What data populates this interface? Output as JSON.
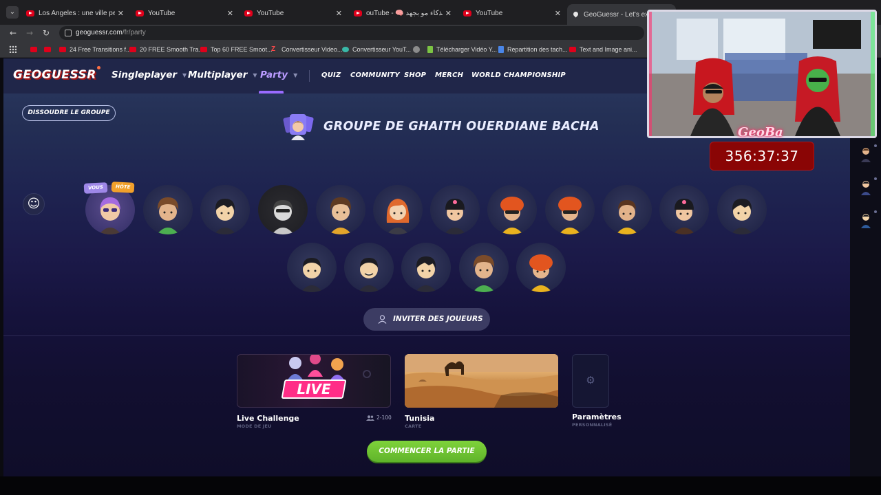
{
  "browser": {
    "tabs": [
      {
        "label": "Los Angeles : une ville peuplée",
        "icon": "youtube-icon"
      },
      {
        "label": "YouTube",
        "icon": "youtube-icon"
      },
      {
        "label": "YouTube",
        "icon": "youtube-icon"
      },
      {
        "label": "ouTube - 🧠 اعمل بذكاء مو بجهد",
        "icon": "youtube-icon"
      },
      {
        "label": "YouTube",
        "icon": "youtube-icon"
      },
      {
        "label": "GeoGuessr - Let's explore",
        "icon": "geoguessr-pin-icon"
      }
    ],
    "url_host": "geoguessr.com",
    "url_path": "/fr/party",
    "bookmarks": [
      "24 Free Transitions f...",
      "20 FREE Smooth Tra...",
      "Top 60 FREE Smoot...",
      "Convertisseur Video...",
      "Convertisseur YouT...",
      "Télécharger Vidéo Y...",
      "Repartition des tach...",
      "Text and Image ani..."
    ]
  },
  "nav": {
    "logo": "GEOGUESSR",
    "singleplayer": "Singleplayer",
    "multiplayer": "Multiplayer",
    "party": "Party",
    "quiz": "QUIZ",
    "community": "COMMUNITY",
    "shop": "SHOP",
    "merch": "MERCH",
    "world_championship": "WORLD CHAMPIONSHIP"
  },
  "party": {
    "dissolve_label": "DISSOUDRE LE GROUPE",
    "title": "GROUPE DE GHAITH OUERDIANE BACHA",
    "badge_you": "VOUS",
    "badge_host": "HÔTE",
    "invite_label": "INVITER DES JOUEURS",
    "start_label": "COMMENCER LA PARTIE"
  },
  "cards": {
    "live": {
      "badge": "LIVE",
      "title": "Live Challenge",
      "subtitle": "MODE DE JEU",
      "players": "2-100"
    },
    "map": {
      "title": "Tunisia",
      "subtitle": "CARTE"
    },
    "settings": {
      "title": "Paramètres",
      "subtitle": "PERSONNALISÉ"
    }
  },
  "overlay": {
    "streamer_tag": "GeoBa",
    "timer": "356:37:37"
  },
  "colors": {
    "accent_purple": "#9a6bff",
    "start_green": "#6cc431",
    "host_orange": "#f2a02b",
    "timer_red": "#8a0505"
  }
}
